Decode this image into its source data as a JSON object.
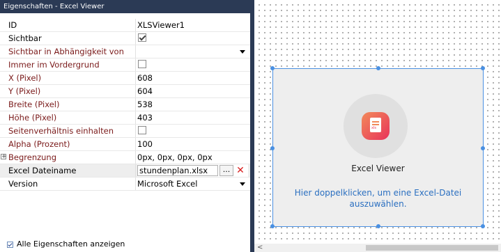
{
  "panel": {
    "title": "Eigenschaften - Excel Viewer",
    "rows": [
      {
        "name": "ID",
        "value": "XLSViewer1"
      },
      {
        "name": "Sichtbar",
        "value": ""
      },
      {
        "name": "Sichtbar in Abhängigkeit von",
        "value": ""
      },
      {
        "name": "Immer im Vordergrund",
        "value": ""
      },
      {
        "name": "X (Pixel)",
        "value": "608"
      },
      {
        "name": "Y (Pixel)",
        "value": "604"
      },
      {
        "name": "Breite (Pixel)",
        "value": "538"
      },
      {
        "name": "Höhe (Pixel)",
        "value": "403"
      },
      {
        "name": "Seitenverhältnis einhalten",
        "value": ""
      },
      {
        "name": "Alpha (Prozent)",
        "value": "100"
      },
      {
        "name": "Begrenzung",
        "value": "0px, 0px, 0px, 0px"
      },
      {
        "name": "Excel Dateiname",
        "value": "stundenplan.xlsx"
      },
      {
        "name": "Version",
        "value": "Microsoft Excel"
      }
    ],
    "browse_label": "...",
    "clear_label": "✕",
    "expand_label": "+",
    "show_all_label": "Alle Eigenschaften anzeigen"
  },
  "widget": {
    "title": "Excel Viewer",
    "hint": "Hier doppelklicken, um eine Excel-Datei auszuwählen."
  },
  "scrollbar": {
    "left_arrow": "<"
  }
}
